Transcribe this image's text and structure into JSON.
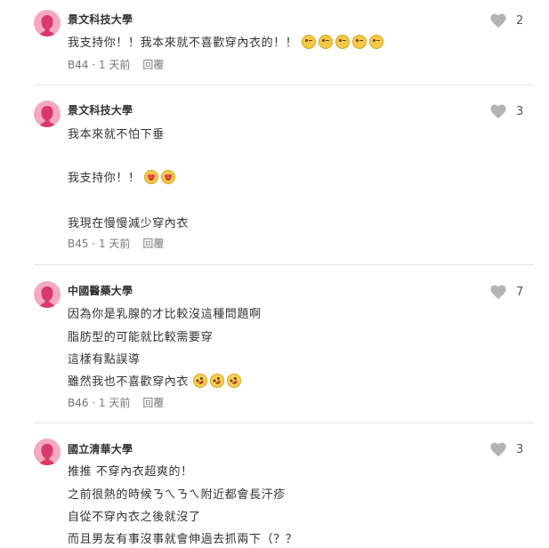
{
  "comments": [
    {
      "school": "景文科技大學",
      "lines": [
        "我支持你！！我本來就不喜歡穿內衣的！！"
      ],
      "meta": "B44 · 1 天前",
      "reply": "回覆",
      "likes": "2",
      "emoji_line0": [
        "kissing-face",
        "kissing-face",
        "kissing-face",
        "kissing-face",
        "kissing-face"
      ]
    },
    {
      "school": "景文科技大學",
      "lines": [
        "我本來就不怕下垂",
        "我支持你！！",
        "我現在慢慢減少穿內衣"
      ],
      "meta": "B45 · 1 天前",
      "reply": "回覆",
      "likes": "3",
      "emoji_line1": [
        "heart-eyes-face",
        "heart-eyes-face"
      ]
    },
    {
      "school": "中國醫藥大學",
      "lines": [
        "因為你是乳腺的才比較沒這種問題啊",
        "脂肪型的可能就比較需要穿",
        "這樣有點誤導",
        "雖然我也不喜歡穿內衣"
      ],
      "meta": "B46 · 1 天前",
      "reply": "回覆",
      "likes": "7",
      "emoji_line3": [
        "rolling-laughing-face",
        "rolling-laughing-face",
        "rolling-laughing-face"
      ]
    },
    {
      "school": "國立清華大學",
      "lines": [
        "推推 不穿內衣超爽的！",
        "之前很熱的時候ㄋㄟㄋㄟ附近都會長汗疹",
        "自從不穿內衣之後就沒了",
        "而且男友有事沒事就會伸過去抓兩下（？？"
      ],
      "likes": "3"
    }
  ],
  "colors": {
    "avatar_bg": "#f4a9be",
    "avatar_fg": "#d9386a",
    "heart": "#b3b3b3",
    "meta_text": "#777777",
    "divider": "#e6e6e6"
  },
  "icons": [
    "female-avatar-icon",
    "heart-icon",
    "emoji-icon"
  ]
}
